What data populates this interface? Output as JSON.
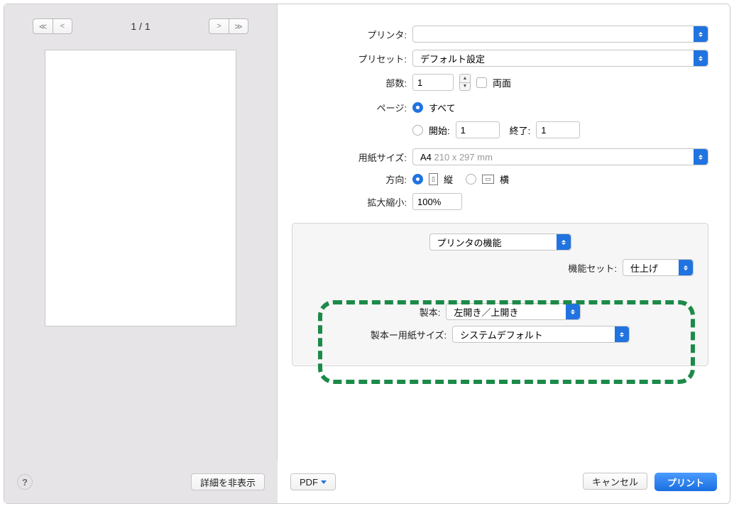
{
  "preview": {
    "page_readout": "1 / 1"
  },
  "labels": {
    "printer": "プリンタ:",
    "preset": "プリセット:",
    "copies": "部数:",
    "duplex": "両面",
    "pages": "ページ:",
    "all": "すべて",
    "from": "開始:",
    "to": "終了:",
    "paper_size": "用紙サイズ:",
    "orientation": "方向:",
    "portrait": "縦",
    "landscape": "横",
    "scale": "拡大縮小:"
  },
  "values": {
    "printer": "　　　　　",
    "preset": "デフォルト設定",
    "copies": "1",
    "from": "1",
    "to": "1",
    "paper_size_main": "A4",
    "paper_size_dim": "210 x 297 mm",
    "scale": "100%"
  },
  "features": {
    "section_title": "プリンタの機能",
    "set_label": "機能セット:",
    "set_value": "仕上げ",
    "binding_label": "製本:",
    "binding_value": "左開き／上開き",
    "binding_paper_label": "製本ー用紙サイズ:",
    "binding_paper_value": "システムデフォルト"
  },
  "bottom": {
    "hide_details": "詳細を非表示",
    "pdf": "PDF",
    "cancel": "キャンセル",
    "print": "プリント",
    "help": "?"
  }
}
